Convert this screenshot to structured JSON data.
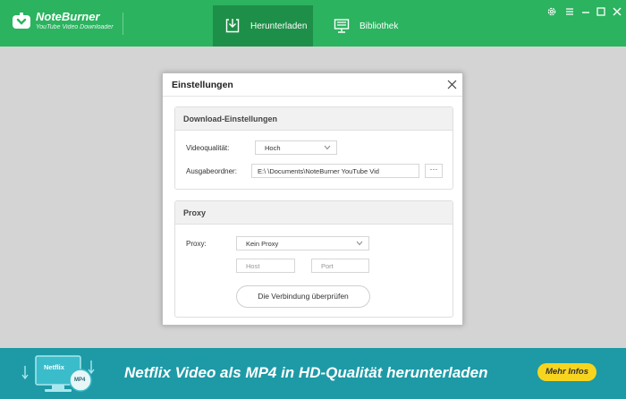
{
  "app": {
    "name": "NoteBurner",
    "subtitle": "YouTube Video Downloader"
  },
  "nav": {
    "tabs": [
      {
        "label": "Herunterladen",
        "active": true,
        "icon": "download-icon"
      },
      {
        "label": "Bibliothek",
        "active": false,
        "icon": "monitor-icon"
      }
    ]
  },
  "window_controls": [
    "gear-icon",
    "minimize-icon",
    "maximize-icon",
    "close-icon"
  ],
  "dialog": {
    "title": "Einstellungen",
    "download_section": {
      "title": "Download-Einstellungen",
      "quality_label": "Videoqualität:",
      "quality_value": "Hoch",
      "output_label": "Ausgabeordner:",
      "output_value": "E:\\ \\Documents\\NoteBurner YouTube Vid",
      "browse_label": "···"
    },
    "proxy_section": {
      "title": "Proxy",
      "proxy_label": "Proxy:",
      "proxy_value": "Kein Proxy",
      "host_placeholder": "Host",
      "port_placeholder": "Port",
      "check_button": "Die Verbindung überprüfen"
    }
  },
  "banner": {
    "text": "Netflix Video als MP4 in HD-Qualität herunterladen",
    "button": "Mehr Infos",
    "art_label_1": "Netflix",
    "art_label_2": "MP4"
  },
  "colors": {
    "header": "#2bb35f",
    "header_active": "#1e8f48",
    "banner": "#1d9aa6",
    "banner_button": "#f7d51f"
  }
}
